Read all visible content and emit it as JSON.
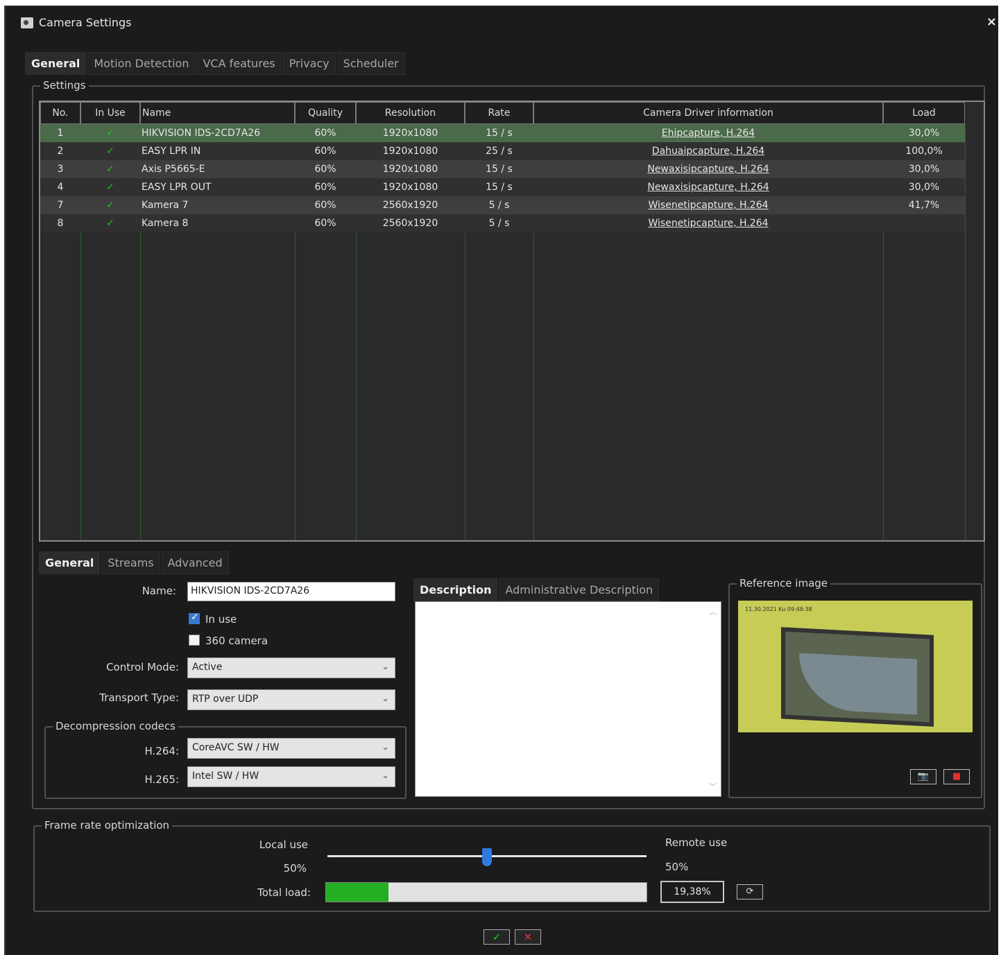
{
  "window": {
    "title": "Camera Settings",
    "close": "×"
  },
  "main_tabs": [
    "General",
    "Motion Detection",
    "VCA features",
    "Privacy",
    "Scheduler"
  ],
  "settings_group": "Settings",
  "table": {
    "headers": [
      "No.",
      "In Use",
      "Name",
      "Quality",
      "Resolution",
      "Rate",
      "Camera Driver information",
      "Load"
    ],
    "rows": [
      {
        "no": "1",
        "in_use": "✓",
        "name": "HIKVISION IDS-2CD7A26",
        "quality": "60%",
        "resolution": "1920x1080",
        "rate": "15 / s",
        "driver": "Ehipcapture, H.264",
        "load": "30,0%"
      },
      {
        "no": "2",
        "in_use": "✓",
        "name": "EASY LPR IN",
        "quality": "60%",
        "resolution": "1920x1080",
        "rate": "25 / s",
        "driver": "Dahuaipcapture, H.264",
        "load": "100,0%"
      },
      {
        "no": "3",
        "in_use": "✓",
        "name": "Axis P5665-E",
        "quality": "60%",
        "resolution": "1920x1080",
        "rate": "15 / s",
        "driver": "Newaxisipcapture, H.264",
        "load": "30,0%"
      },
      {
        "no": "4",
        "in_use": "✓",
        "name": "EASY LPR OUT",
        "quality": "60%",
        "resolution": "1920x1080",
        "rate": "15 / s",
        "driver": "Newaxisipcapture, H.264",
        "load": "30,0%"
      },
      {
        "no": "7",
        "in_use": "✓",
        "name": "Kamera 7",
        "quality": "60%",
        "resolution": "2560x1920",
        "rate": "5 / s",
        "driver": "Wisenetipcapture, H.264",
        "load": "41,7%"
      },
      {
        "no": "8",
        "in_use": "✓",
        "name": "Kamera 8",
        "quality": "60%",
        "resolution": "2560x1920",
        "rate": "5 / s",
        "driver": "Wisenetipcapture, H.264",
        "load": ""
      }
    ],
    "selected_row": 0
  },
  "sub_tabs": [
    "General",
    "Streams",
    "Advanced"
  ],
  "form": {
    "name_label": "Name:",
    "name_value": "HIKVISION IDS-2CD7A26",
    "in_use_label": "In use",
    "in_use_checked": true,
    "camera360_label": "360 camera",
    "camera360_checked": false,
    "control_mode_label": "Control Mode:",
    "control_mode_value": "Active",
    "transport_type_label": "Transport Type:",
    "transport_type_value": "RTP over UDP",
    "decomp_group": "Decompression codecs",
    "h264_label": "H.264:",
    "h264_value": "CoreAVC SW / HW",
    "h265_label": "H.265:",
    "h265_value": "Intel SW / HW"
  },
  "description_tabs": [
    "Description",
    "Administrative Description"
  ],
  "reference": {
    "group": "Reference image",
    "timestamp": "11.30.2021 Ku 09:48:38",
    "snapshot_icon": "camera-icon",
    "delete_icon": "delete-image-icon"
  },
  "frame_rate": {
    "group": "Frame rate optimization",
    "local_label": "Local use",
    "local_value": "50%",
    "remote_label": "Remote use",
    "remote_value": "50%",
    "slider_fraction": 0.5,
    "total_label": "Total load:",
    "total_value": "19,38%",
    "total_fraction": 0.1938,
    "refresh_icon": "refresh-icon"
  },
  "buttons": {
    "ok": "✓",
    "cancel": "✕"
  },
  "colors": {
    "check": "#22c422",
    "selected_row": "#4a6a4a",
    "progress": "#22b022",
    "slider": "#2f7ae0"
  }
}
